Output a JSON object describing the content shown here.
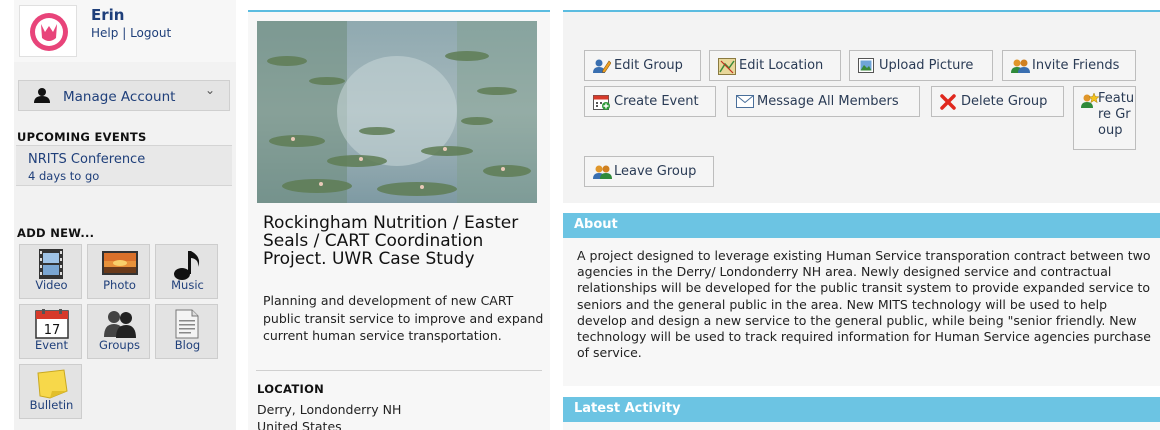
{
  "user": {
    "name": "Erin",
    "help_label": "Help",
    "separator": "|",
    "logout_label": "Logout"
  },
  "sidebar": {
    "manage_account_label": "Manage Account",
    "upcoming_events_heading": "UPCOMING EVENTS",
    "events": [
      {
        "name": "NRITS Conference",
        "when": "4 days to go"
      }
    ],
    "add_new_heading": "ADD NEW...",
    "add_new_items": [
      {
        "label": "Video",
        "icon": "film-icon"
      },
      {
        "label": "Photo",
        "icon": "photo-icon"
      },
      {
        "label": "Music",
        "icon": "music-note-icon"
      },
      {
        "label": "Event",
        "icon": "calendar-icon"
      },
      {
        "label": "Groups",
        "icon": "groups-icon"
      },
      {
        "label": "Blog",
        "icon": "document-icon"
      },
      {
        "label": "Bulletin",
        "icon": "sticky-note-icon"
      }
    ],
    "calendar_day": "17"
  },
  "group": {
    "title": "Rockingham Nutrition / Easter Seals / CART Coordination Project. UWR Case Study",
    "description": "Planning and development of new CART public transit service to improve and expand current human service transportation.",
    "location_heading": "LOCATION",
    "location_line1": "Derry, Londonderry NH",
    "location_line2": "United States"
  },
  "actions": [
    {
      "label": "Edit Group",
      "icon": "edit-group-icon"
    },
    {
      "label": "Edit Location",
      "icon": "map-icon"
    },
    {
      "label": "Upload Picture",
      "icon": "picture-icon"
    },
    {
      "label": "Invite Friends",
      "icon": "invite-friends-icon"
    },
    {
      "label": "Create Event",
      "icon": "calendar-add-icon"
    },
    {
      "label": "Message All Members",
      "icon": "envelope-icon"
    },
    {
      "label": "Delete Group",
      "icon": "delete-icon"
    },
    {
      "label": "Feature Group",
      "icon": "feature-icon"
    },
    {
      "label": "Leave Group",
      "icon": "leave-group-icon"
    }
  ],
  "about": {
    "heading": "About",
    "text": "A project designed to leverage existing Human Service transporation contract between two agencies in the Derry/ Londonderry NH area. Newly designed service and contractual relationships will be developed for the public transit system to provide expanded service to seniors and the general public in the area. New MITS technology will be used to help develop and design a new service to the general public, while being \"senior friendly. New technology will be used to track required information for Human Service agencies purchase of service."
  },
  "latest_activity": {
    "heading": "Latest Activity"
  },
  "colors": {
    "accent": "#6cc4e3",
    "link": "#1f3f7a",
    "delete": "#e0281e"
  }
}
